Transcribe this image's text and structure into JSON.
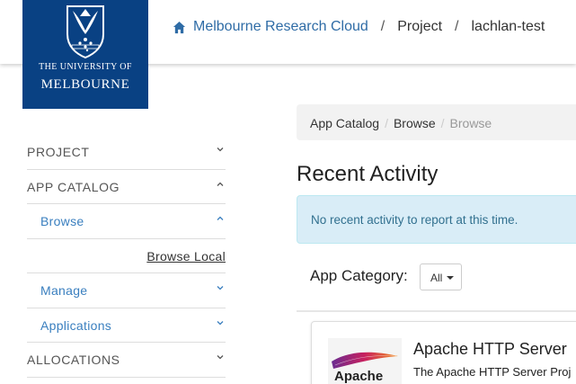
{
  "header": {
    "breadcrumb": {
      "home_label": "Melbourne Research Cloud",
      "project_label": "Project",
      "current_project": "lachlan-test",
      "separator": "/"
    }
  },
  "logo": {
    "line1": "THE UNIVERSITY OF",
    "line2": "MELBOURNE"
  },
  "sidebar": {
    "items": [
      {
        "label": "PROJECT"
      },
      {
        "label": "APP CATALOG"
      },
      {
        "label": "Browse"
      },
      {
        "label": "Browse Local"
      },
      {
        "label": "Manage"
      },
      {
        "label": "Applications"
      },
      {
        "label": "ALLOCATIONS"
      }
    ]
  },
  "main": {
    "breadcrumb": [
      "App Catalog",
      "Browse",
      "Browse"
    ],
    "breadcrumb_separator": "/",
    "recent_activity_title": "Recent Activity",
    "alert_text": "No recent activity to report at this time.",
    "category_label": "App Category:",
    "category_value": "All",
    "app_card": {
      "name": "Apache HTTP Server",
      "description": "The Apache HTTP Server Proj",
      "logo_word": "Apache"
    }
  },
  "colors": {
    "brand_navy": "#094183",
    "link_blue": "#3a7fbf",
    "alert_bg": "#d9edf7",
    "alert_text": "#31708f"
  },
  "icons": {
    "home": "home-icon",
    "chevron_down": "chevron-down-icon",
    "chevron_up": "chevron-up-icon",
    "caret": "caret-down-icon"
  }
}
